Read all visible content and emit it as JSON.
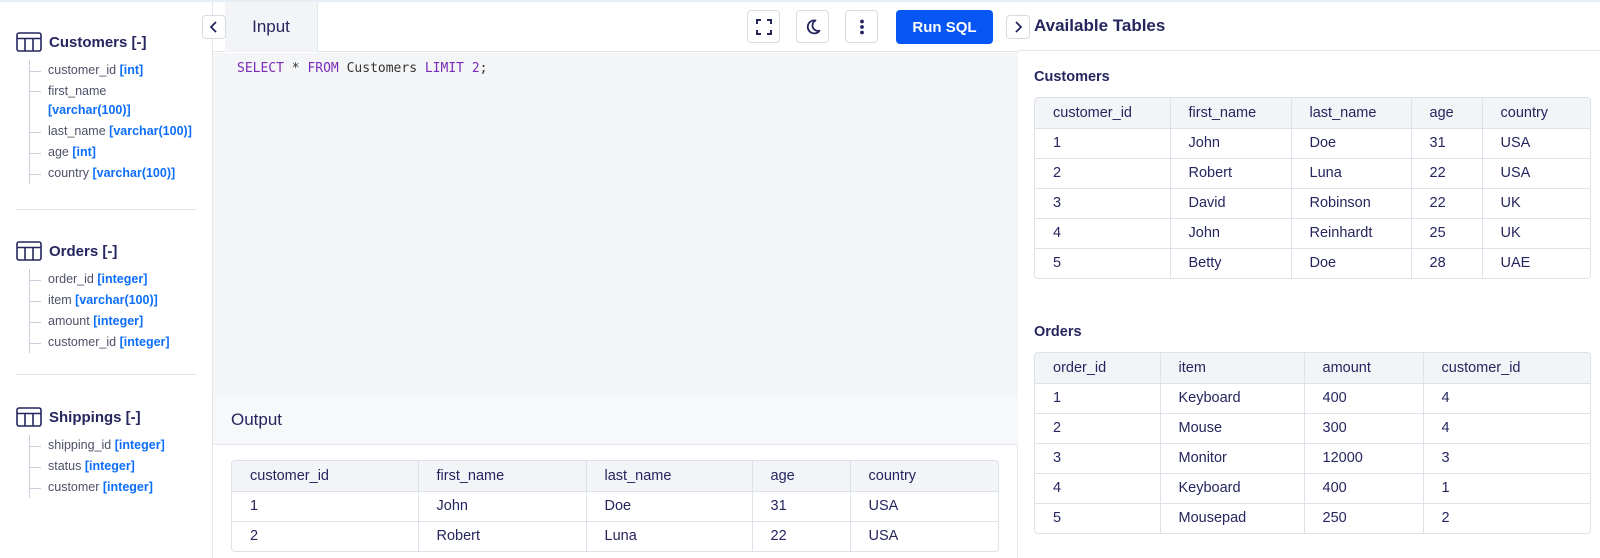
{
  "sidebar": {
    "schemas": [
      {
        "title": "Customers [-]",
        "columns": [
          {
            "name": "customer_id",
            "type": "[int]"
          },
          {
            "name": "first_name",
            "type": "[varchar(100)]"
          },
          {
            "name": "last_name",
            "type": "[varchar(100)]"
          },
          {
            "name": "age",
            "type": "[int]"
          },
          {
            "name": "country",
            "type": "[varchar(100)]"
          }
        ]
      },
      {
        "title": "Orders [-]",
        "columns": [
          {
            "name": "order_id",
            "type": "[integer]"
          },
          {
            "name": "item",
            "type": "[varchar(100)]"
          },
          {
            "name": "amount",
            "type": "[integer]"
          },
          {
            "name": "customer_id",
            "type": "[integer]"
          }
        ]
      },
      {
        "title": "Shippings [-]",
        "columns": [
          {
            "name": "shipping_id",
            "type": "[integer]"
          },
          {
            "name": "status",
            "type": "[integer]"
          },
          {
            "name": "customer",
            "type": "[integer]"
          }
        ]
      }
    ]
  },
  "toolbar": {
    "input_tab": "Input",
    "run_label": "Run SQL",
    "icons": [
      "expand-icon",
      "moon-icon",
      "more-vertical-icon"
    ]
  },
  "editor": {
    "kw_select": "SELECT",
    "star": " * ",
    "kw_from": "FROM",
    "table": " Customers ",
    "kw_limit": "LIMIT",
    "space": " ",
    "limit_value": "2",
    "semicolon": ";"
  },
  "output": {
    "title": "Output",
    "headers": [
      "customer_id",
      "first_name",
      "last_name",
      "age",
      "country"
    ],
    "rows": [
      [
        "1",
        "John",
        "Doe",
        "31",
        "USA"
      ],
      [
        "2",
        "Robert",
        "Luna",
        "22",
        "USA"
      ]
    ]
  },
  "available": {
    "title": "Available Tables",
    "tables": [
      {
        "name": "Customers",
        "headers": [
          "customer_id",
          "first_name",
          "last_name",
          "age",
          "country"
        ],
        "rows": [
          [
            "1",
            "John",
            "Doe",
            "31",
            "USA"
          ],
          [
            "2",
            "Robert",
            "Luna",
            "22",
            "USA"
          ],
          [
            "3",
            "David",
            "Robinson",
            "22",
            "UK"
          ],
          [
            "4",
            "John",
            "Reinhardt",
            "25",
            "UK"
          ],
          [
            "5",
            "Betty",
            "Doe",
            "28",
            "UAE"
          ]
        ]
      },
      {
        "name": "Orders",
        "headers": [
          "order_id",
          "item",
          "amount",
          "customer_id"
        ],
        "rows": [
          [
            "1",
            "Keyboard",
            "400",
            "4"
          ],
          [
            "2",
            "Mouse",
            "300",
            "4"
          ],
          [
            "3",
            "Monitor",
            "12000",
            "3"
          ],
          [
            "4",
            "Keyboard",
            "400",
            "1"
          ],
          [
            "5",
            "Mousepad",
            "250",
            "2"
          ]
        ]
      }
    ]
  }
}
